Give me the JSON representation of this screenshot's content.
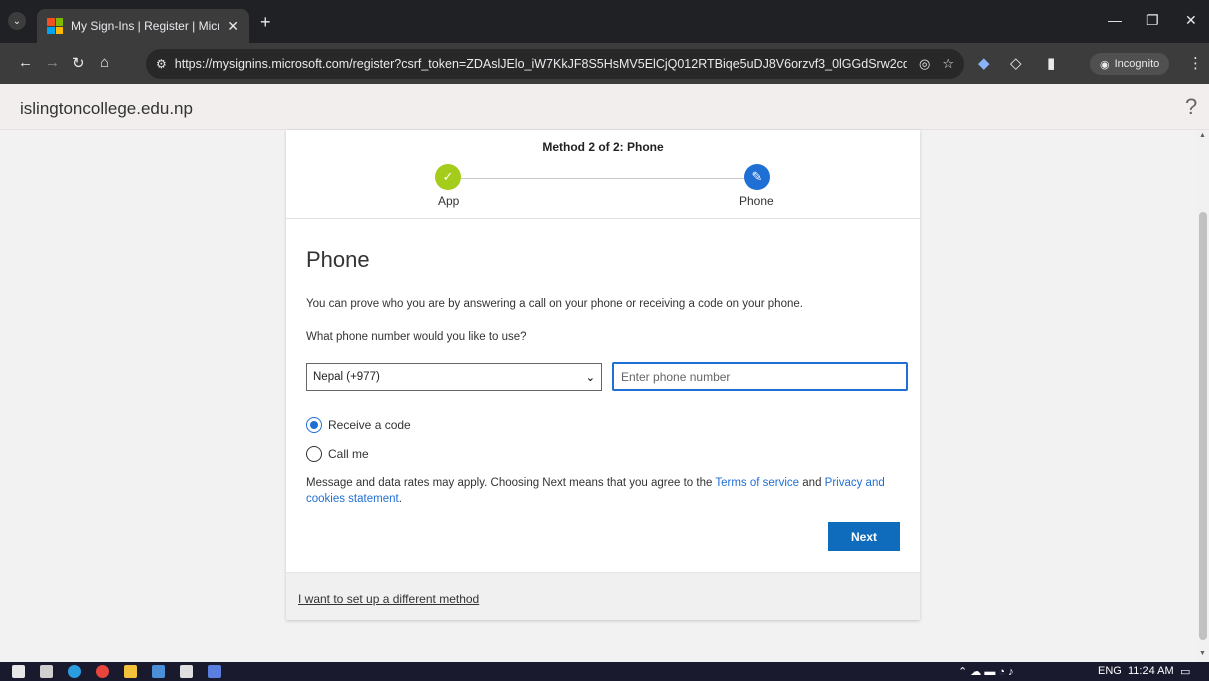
{
  "browser": {
    "tab_title": "My Sign-Ins | Register | Microsc",
    "url": "https://mysignins.microsoft.com/register?csrf_token=ZDAslJElo_iW7KkJF8S5HsMV5ElCjQ012RTBiqe5uDJ8V6orzvf3_0lGGdSrw2cqw5...",
    "incognito_label": "Incognito"
  },
  "header": {
    "domain": "islingtoncollege.edu.np",
    "help_glyph": "?"
  },
  "wizard": {
    "method_title": "Method 2 of 2: Phone",
    "steps": [
      {
        "label": "App",
        "status": "complete"
      },
      {
        "label": "Phone",
        "status": "current"
      }
    ]
  },
  "form": {
    "heading": "Phone",
    "description": "You can prove who you are by answering a call on your phone or receiving a code on your phone.",
    "question": "What phone number would you like to use?",
    "country_selected": "Nepal (+977)",
    "phone_placeholder": "Enter phone number",
    "phone_value": "",
    "options": [
      {
        "label": "Receive a code",
        "checked": true
      },
      {
        "label": "Call me",
        "checked": false
      }
    ],
    "terms_prefix": "Message and data rates may apply. Choosing Next means that you agree to the ",
    "terms_link": "Terms of service",
    "terms_and": " and ",
    "privacy_link": "Privacy and cookies statement",
    "terms_suffix": ".",
    "next_label": "Next"
  },
  "footer": {
    "different_method_link": "I want to set up a different method"
  },
  "taskbar": {
    "language": "ENG",
    "time": "11:24 AM"
  },
  "colors": {
    "accent": "#0f6cbd",
    "complete_green": "#a4cc1a"
  }
}
